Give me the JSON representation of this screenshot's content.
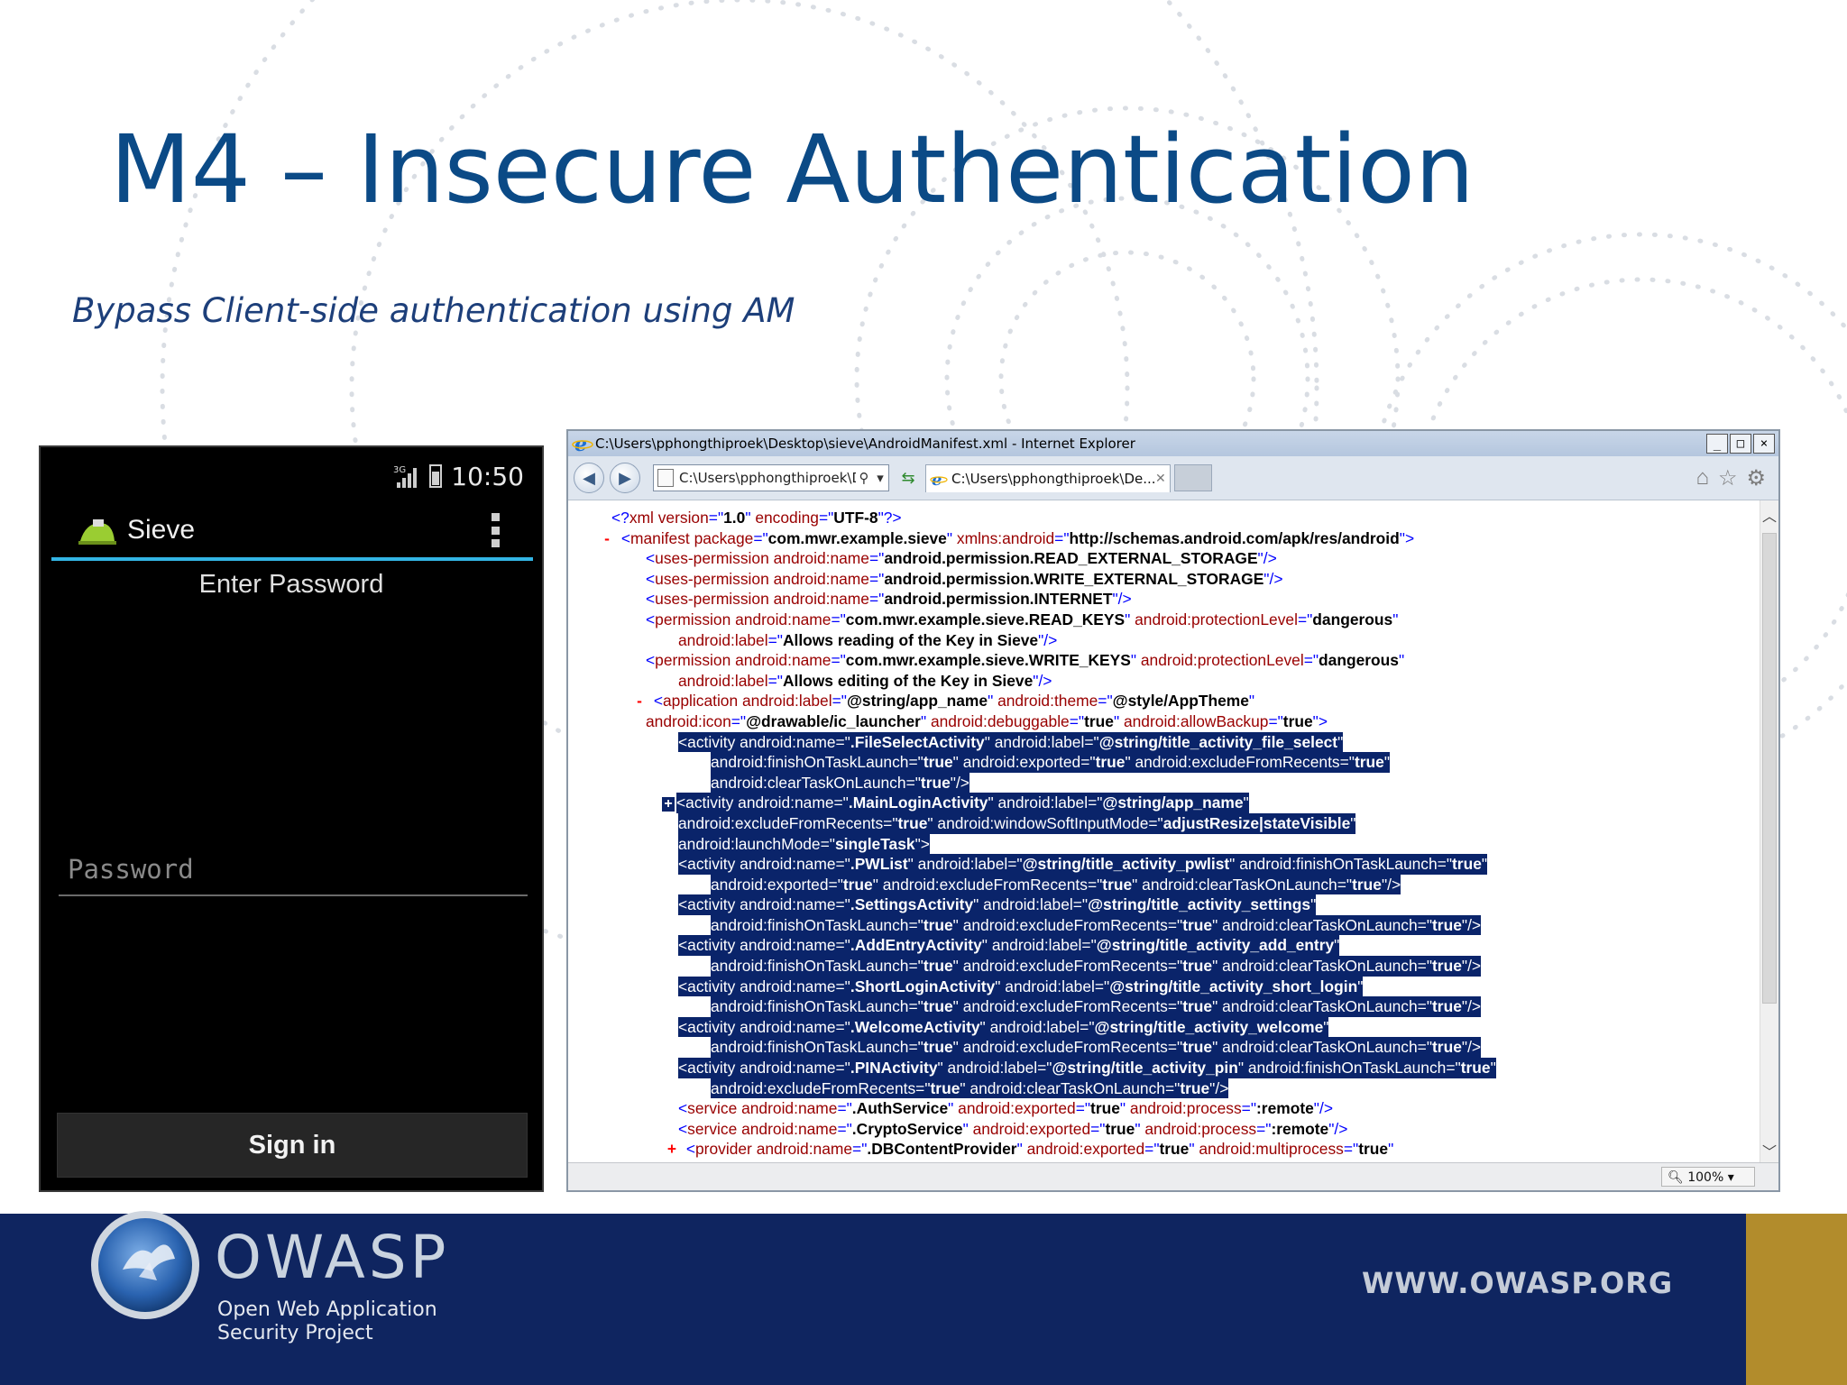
{
  "slide": {
    "title": "M4 – Insecure Authentication",
    "subtitle": "Bypass Client-side authentication using AM"
  },
  "phone": {
    "status_time": "10:50",
    "network_label": "3G",
    "app_name": "Sieve",
    "prompt": "Enter Password",
    "password_placeholder": "Password",
    "signin_label": "Sign in"
  },
  "browser": {
    "window_title": "C:\\Users\\pphongthiproek\\Desktop\\sieve\\AndroidManifest.xml - Internet Explorer",
    "window_buttons": [
      "_",
      "□",
      "×"
    ],
    "address": "C:\\Users\\pphongthiproek\\De:",
    "tab_title": "C:\\Users\\pphongthiproek\\De...",
    "zoom": "100%",
    "toolbar_icons": [
      "home-icon",
      "favorites-star-icon",
      "tools-gear-icon"
    ],
    "xml_lines": [
      {
        "indent": 30,
        "gutter": "",
        "selected": false,
        "text": "<?xml version=\"1.0\" encoding=\"UTF-8\"?>"
      },
      {
        "indent": 14,
        "gutter": "-",
        "selected": false,
        "text": "<manifest package=\"com.mwr.example.sieve\" xmlns:android=\"http://schemas.android.com/apk/res/android\">"
      },
      {
        "indent": 68,
        "gutter": "",
        "selected": false,
        "text": "<uses-permission android:name=\"android.permission.READ_EXTERNAL_STORAGE\"/>"
      },
      {
        "indent": 68,
        "gutter": "",
        "selected": false,
        "text": "<uses-permission android:name=\"android.permission.WRITE_EXTERNAL_STORAGE\"/>"
      },
      {
        "indent": 68,
        "gutter": "",
        "selected": false,
        "text": "<uses-permission android:name=\"android.permission.INTERNET\"/>"
      },
      {
        "indent": 68,
        "gutter": "",
        "selected": false,
        "text": "<permission android:name=\"com.mwr.example.sieve.READ_KEYS\" android:protectionLevel=\"dangerous\""
      },
      {
        "indent": 104,
        "gutter": "",
        "selected": false,
        "text": "android:label=\"Allows reading of the Key in Sieve\"/>"
      },
      {
        "indent": 68,
        "gutter": "",
        "selected": false,
        "text": "<permission android:name=\"com.mwr.example.sieve.WRITE_KEYS\" android:protectionLevel=\"dangerous\""
      },
      {
        "indent": 104,
        "gutter": "",
        "selected": false,
        "text": "android:label=\"Allows editing of the Key in Sieve\"/>"
      },
      {
        "indent": 50,
        "gutter": "-",
        "selected": false,
        "text": "<application android:label=\"@string/app_name\" android:theme=\"@style/AppTheme\""
      },
      {
        "indent": 68,
        "gutter": "",
        "selected": false,
        "text": "android:icon=\"@drawable/ic_launcher\" android:debuggable=\"true\" android:allowBackup=\"true\">"
      },
      {
        "indent": 104,
        "gutter": "",
        "selected": true,
        "text": "<activity android:name=\".FileSelectActivity\" android:label=\"@string/title_activity_file_select\""
      },
      {
        "indent": 140,
        "gutter": "",
        "selected": true,
        "text": "android:finishOnTaskLaunch=\"true\" android:exported=\"true\" android:excludeFromRecents=\"true\""
      },
      {
        "indent": 140,
        "gutter": "",
        "selected": true,
        "text": "android:clearTaskOnLaunch=\"true\"/>"
      },
      {
        "indent": 86,
        "gutter": "+",
        "selected": true,
        "text": "<activity android:name=\".MainLoginActivity\" android:label=\"@string/app_name\""
      },
      {
        "indent": 104,
        "gutter": "",
        "selected": true,
        "text": "android:excludeFromRecents=\"true\" android:windowSoftInputMode=\"adjustResize|stateVisible\""
      },
      {
        "indent": 104,
        "gutter": "",
        "selected": true,
        "text": "android:launchMode=\"singleTask\">"
      },
      {
        "indent": 104,
        "gutter": "",
        "selected": true,
        "text": "<activity android:name=\".PWList\" android:label=\"@string/title_activity_pwlist\" android:finishOnTaskLaunch=\"true\""
      },
      {
        "indent": 140,
        "gutter": "",
        "selected": true,
        "text": "android:exported=\"true\" android:excludeFromRecents=\"true\" android:clearTaskOnLaunch=\"true\"/>"
      },
      {
        "indent": 104,
        "gutter": "",
        "selected": true,
        "text": "<activity android:name=\".SettingsActivity\" android:label=\"@string/title_activity_settings\""
      },
      {
        "indent": 140,
        "gutter": "",
        "selected": true,
        "text": "android:finishOnTaskLaunch=\"true\" android:excludeFromRecents=\"true\" android:clearTaskOnLaunch=\"true\"/>"
      },
      {
        "indent": 104,
        "gutter": "",
        "selected": true,
        "text": "<activity android:name=\".AddEntryActivity\" android:label=\"@string/title_activity_add_entry\""
      },
      {
        "indent": 140,
        "gutter": "",
        "selected": true,
        "text": "android:finishOnTaskLaunch=\"true\" android:excludeFromRecents=\"true\" android:clearTaskOnLaunch=\"true\"/>"
      },
      {
        "indent": 104,
        "gutter": "",
        "selected": true,
        "text": "<activity android:name=\".ShortLoginActivity\" android:label=\"@string/title_activity_short_login\""
      },
      {
        "indent": 140,
        "gutter": "",
        "selected": true,
        "text": "android:finishOnTaskLaunch=\"true\" android:excludeFromRecents=\"true\" android:clearTaskOnLaunch=\"true\"/>"
      },
      {
        "indent": 104,
        "gutter": "",
        "selected": true,
        "text": "<activity android:name=\".WelcomeActivity\" android:label=\"@string/title_activity_welcome\""
      },
      {
        "indent": 140,
        "gutter": "",
        "selected": true,
        "text": "android:finishOnTaskLaunch=\"true\" android:excludeFromRecents=\"true\" android:clearTaskOnLaunch=\"true\"/>"
      },
      {
        "indent": 104,
        "gutter": "",
        "selected": true,
        "text": "<activity android:name=\".PINActivity\" android:label=\"@string/title_activity_pin\" android:finishOnTaskLaunch=\"true\""
      },
      {
        "indent": 140,
        "gutter": "",
        "selected": true,
        "text": "android:excludeFromRecents=\"true\" android:clearTaskOnLaunch=\"true\"/>"
      },
      {
        "indent": 104,
        "gutter": "",
        "selected": false,
        "text": "<service android:name=\".AuthService\" android:exported=\"true\" android:process=\":remote\"/>"
      },
      {
        "indent": 104,
        "gutter": "",
        "selected": false,
        "text": "<service android:name=\".CryptoService\" android:exported=\"true\" android:process=\":remote\"/>"
      },
      {
        "indent": 86,
        "gutter": "+",
        "selected": false,
        "text": "<provider android:name=\".DBContentProvider\" android:exported=\"true\" android:multiprocess=\"true\""
      }
    ]
  },
  "footer": {
    "brand": "OWASP",
    "tagline_line1": "Open Web Application",
    "tagline_line2": "Security Project",
    "url": "WWW.OWASP.ORG",
    "colors": {
      "navy": "#0f2560",
      "gold": "#b28c2c",
      "title_blue": "#0b4a86"
    }
  }
}
